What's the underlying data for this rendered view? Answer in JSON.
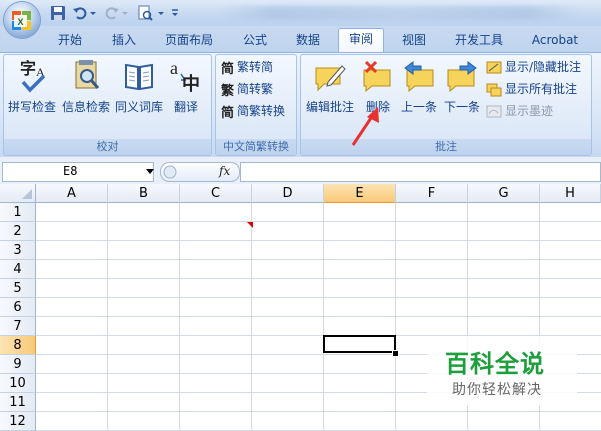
{
  "quick_access": {
    "icons": [
      "excel-logo-icon",
      "save-icon",
      "undo-icon",
      "redo-icon",
      "print-preview-icon",
      "customize-qat-icon"
    ]
  },
  "tabs": [
    "开始",
    "插入",
    "页面布局",
    "公式",
    "数据",
    "审阅",
    "视图",
    "开发工具",
    "Acrobat"
  ],
  "active_tab": "审阅",
  "ribbon": {
    "proofing": {
      "title": "校对",
      "buttons": [
        "拼写检查",
        "信息检索",
        "同义词库",
        "翻译"
      ]
    },
    "chinese_conversion": {
      "title": "中文简繁转换",
      "buttons": [
        "繁转简",
        "简转繁",
        "简繁转换"
      ]
    },
    "comments": {
      "title": "批注",
      "big_buttons": [
        "编辑批注",
        "删除",
        "上一条",
        "下一条"
      ],
      "small_buttons": [
        "显示/隐藏批注",
        "显示所有批注",
        "显示墨迹"
      ],
      "disabled": [
        "显示墨迹"
      ]
    }
  },
  "formula_bar": {
    "name_box": "E8",
    "fx_label": "fx",
    "formula": ""
  },
  "grid": {
    "columns": [
      "A",
      "B",
      "C",
      "D",
      "E",
      "F",
      "G",
      "H"
    ],
    "rows": [
      "1",
      "2",
      "3",
      "4",
      "5",
      "6",
      "7",
      "8",
      "9",
      "10",
      "11",
      "12"
    ],
    "selected_column": "E",
    "selected_row": "8",
    "selected_cell": "E8",
    "comment_cell": "C2"
  },
  "watermark": {
    "title": "百科全说",
    "subtitle": "助你轻松解决"
  },
  "colors": {
    "accent": "#15428b",
    "arrow": "#e8312f",
    "watermark_green": "#1e9e3c"
  }
}
